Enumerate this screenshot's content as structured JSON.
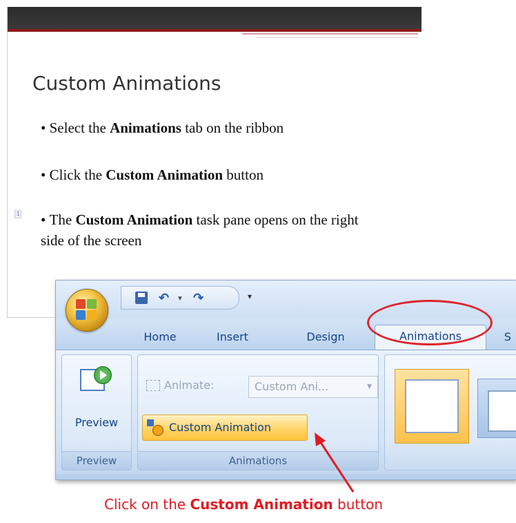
{
  "slide": {
    "title": "Custom Animations",
    "bullets": [
      {
        "prefix": "Select the ",
        "bold": "Animations",
        "suffix": " tab on the ribbon"
      },
      {
        "prefix": "Click the ",
        "bold": "Custom Animation",
        "suffix": " button"
      },
      {
        "prefix": "The ",
        "bold": "Custom Animation",
        "suffix": " task pane opens on the right side of the screen"
      }
    ],
    "slide_number": "1"
  },
  "ribbon": {
    "tabs": [
      "Home",
      "Insert",
      "Design",
      "Animations",
      "S"
    ],
    "active_tab": "Animations",
    "groups": {
      "preview": {
        "button_label": "Preview",
        "group_label": "Preview"
      },
      "animations": {
        "animate_label": "Animate:",
        "animate_value": "Custom Ani...",
        "custom_animation_label": "Custom Animation",
        "group_label": "Animations"
      }
    }
  },
  "callout": {
    "prefix": "Click on the ",
    "bold": "Custom Animation",
    "suffix": " button",
    "color": "#e01b22"
  }
}
